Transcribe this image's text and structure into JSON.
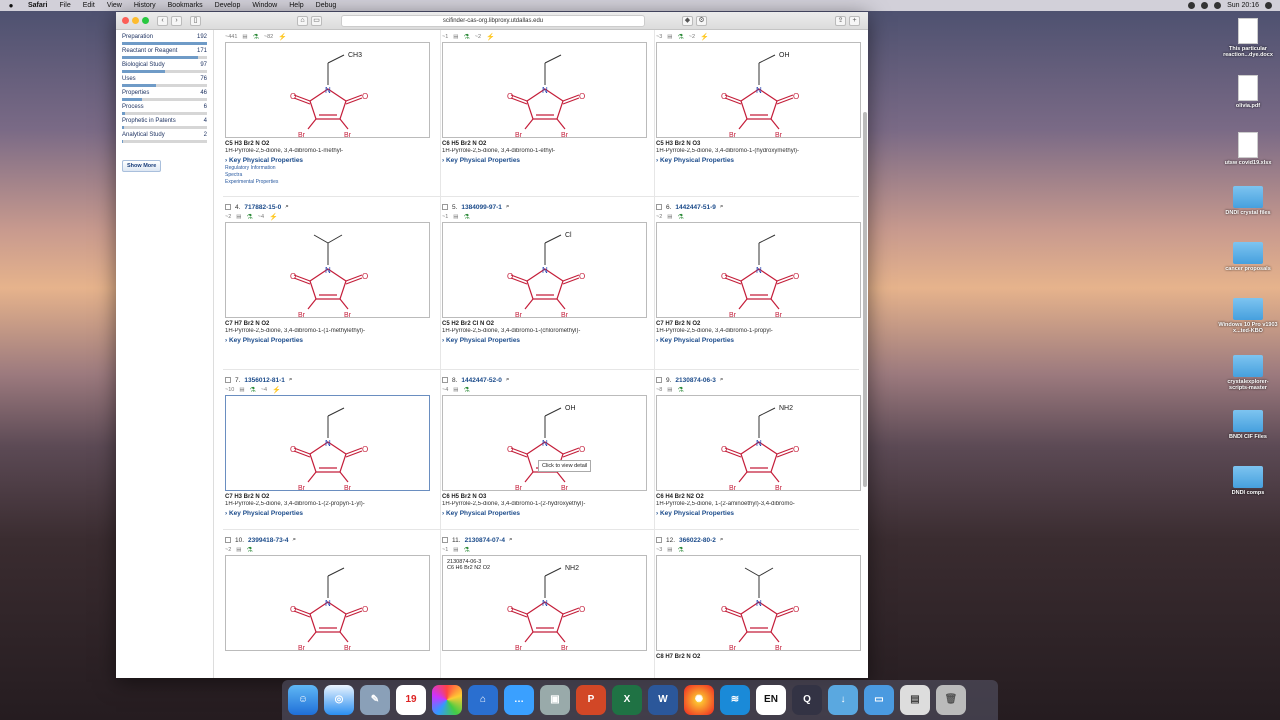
{
  "menubar": {
    "app": "Safari",
    "items": [
      "File",
      "Edit",
      "View",
      "History",
      "Bookmarks",
      "Develop",
      "Window",
      "Help",
      "Debug"
    ],
    "clock": "Sun 20:16"
  },
  "url": "scifinder-cas-org.libproxy.utdallas.edu",
  "filters": [
    {
      "label": "Preparation",
      "count": "192",
      "frac": 1.0
    },
    {
      "label": "Reactant or Reagent",
      "count": "171",
      "frac": 0.89
    },
    {
      "label": "Biological Study",
      "count": "97",
      "frac": 0.51
    },
    {
      "label": "Uses",
      "count": "76",
      "frac": 0.4
    },
    {
      "label": "Properties",
      "count": "46",
      "frac": 0.24
    },
    {
      "label": "Process",
      "count": "6",
      "frac": 0.03
    },
    {
      "label": "Prophetic in Patents",
      "count": "4",
      "frac": 0.02
    },
    {
      "label": "Analytical Study",
      "count": "2",
      "frac": 0.01
    }
  ],
  "show_more": "Show More",
  "kpp": "Key Physical Properties",
  "reg_info": "Regulatory Information",
  "spectra": "Spectra",
  "exp_props": "Experimental Properties",
  "tooltip": "Click to view detail",
  "cards": [
    {
      "num": "",
      "cas": "",
      "formula": "C5 H3 Br2 N O2",
      "name": "1H-Pyrrole-2,5-dione, 3,4-dibromo-1-methyl-",
      "refs": "~441",
      "rx": "~82",
      "sub": "CH3"
    },
    {
      "num": "",
      "cas": "",
      "formula": "C6 H5 Br2 N O2",
      "name": "1H-Pyrrole-2,5-dione, 3,4-dibromo-1-ethyl-",
      "refs": "~1",
      "rx": "~2",
      "sub": ""
    },
    {
      "num": "",
      "cas": "",
      "formula": "C5 H3 Br2 N O3",
      "name": "1H-Pyrrole-2,5-dione, 3,4-dibromo-1-(hydroxymethyl)-",
      "refs": "~3",
      "rx": "~2",
      "sub": "OH"
    },
    {
      "num": "4.",
      "cas": "717882-15-0",
      "formula": "C7 H7 Br2 N O2",
      "name": "1H-Pyrrole-2,5-dione, 3,4-dibromo-1-(1-methylethyl)-",
      "refs": "~2",
      "rx": "~4",
      "sub": ""
    },
    {
      "num": "5.",
      "cas": "1384099-97-1",
      "formula": "C5 H2 Br2 Cl N O2",
      "name": "1H-Pyrrole-2,5-dione, 3,4-dibromo-1-(chloromethyl)-",
      "refs": "~1",
      "rx": "",
      "sub": "Cl"
    },
    {
      "num": "6.",
      "cas": "1442447-51-9",
      "formula": "C7 H7 Br2 N O2",
      "name": "1H-Pyrrole-2,5-dione, 3,4-dibromo-1-propyl-",
      "refs": "~2",
      "rx": "",
      "sub": ""
    },
    {
      "num": "7.",
      "cas": "1356012-81-1",
      "formula": "C7 H3 Br2 N O2",
      "name": "1H-Pyrrole-2,5-dione, 3,4-dibromo-1-(2-propyn-1-yl)-",
      "refs": "~10",
      "rx": "~4",
      "sub": ""
    },
    {
      "num": "8.",
      "cas": "1442447-52-0",
      "formula": "C6 H5 Br2 N O3",
      "name": "1H-Pyrrole-2,5-dione, 3,4-dibromo-1-(2-hydroxyethyl)-",
      "refs": "~4",
      "rx": "",
      "sub": "OH"
    },
    {
      "num": "9.",
      "cas": "2130874-06-3",
      "formula": "C6 H4 Br2 N2 O2",
      "name": "1H-Pyrrole-2,5-dione, 1-(2-aminoethyl)-3,4-dibromo-",
      "refs": "~8",
      "rx": "",
      "sub": "NH2"
    },
    {
      "num": "10.",
      "cas": "2399418-73-4",
      "formula": "",
      "name": "",
      "refs": "~2",
      "rx": "",
      "sub": ""
    },
    {
      "num": "11.",
      "cas": "2130874-07-4",
      "formula": "",
      "name": "",
      "refs": "~1",
      "rx": "",
      "sub": "NH2",
      "inset_cas": "2130874-06-3",
      "inset_formula": "C6 H6 Br2 N2 O2"
    },
    {
      "num": "12.",
      "cas": "366022-80-2",
      "formula": "C8 H7 Br2 N O2",
      "name": "",
      "refs": "~3",
      "rx": "",
      "sub": ""
    }
  ],
  "desktop": [
    "This particular reaction...dye.docx",
    "olivia.pdf",
    "utsw covid19.xlsx",
    "DNDI crystal files",
    "cancer proposals",
    "Windows 10 Pro v1903 x...ted-KBO",
    "crystalexplorer-scripts-master",
    "BNDI CIF Files",
    "DNDI comps"
  ],
  "dock_cal": "19",
  "dock_en": "EN"
}
